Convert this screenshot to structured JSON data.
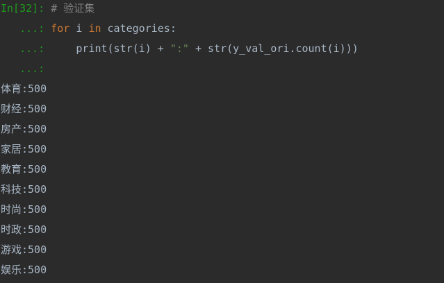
{
  "console": {
    "input_prompt": "In[32]: ",
    "cont_prompt": "   ...: ",
    "comment": "# 验证集",
    "line2": {
      "kw_for": "for",
      "var_i": " i ",
      "kw_in": "in",
      "rest": " categories:"
    },
    "line3": {
      "indent": "    ",
      "code_a": "print(str(i) + ",
      "string": "\":\"",
      "code_b": " + str(y_val_ori.count(i)))"
    },
    "output": [
      "体育:500",
      "财经:500",
      "房产:500",
      "家居:500",
      "教育:500",
      "科技:500",
      "时尚:500",
      "时政:500",
      "游戏:500",
      "娱乐:500"
    ]
  },
  "colors": {
    "background": "#2b2b2b",
    "prompt": "#1e9a1e",
    "keyword": "#cc7832",
    "string": "#6a8759",
    "comment": "#808080",
    "text": "#a9b7c6"
  }
}
